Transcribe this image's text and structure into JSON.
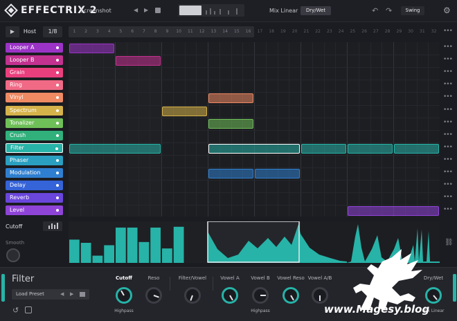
{
  "topbar": {
    "brand": "EFFECTRIX 2",
    "preset": "Screenshot",
    "mix_mode": "Mix Linear",
    "drywet_button": "Dry/Wet",
    "swing_button": "Swing",
    "icons": [
      "logo-icon",
      "prev-arrow-icon",
      "next-arrow-icon",
      "save-icon",
      "undo-icon",
      "redo-icon",
      "gear-icon"
    ]
  },
  "transport": {
    "play_icon": "play-icon",
    "host": "Host",
    "rate": "1/8",
    "steps": [
      "1",
      "2",
      "3",
      "4",
      "5",
      "6",
      "7",
      "8",
      "9",
      "10",
      "11",
      "12",
      "13",
      "14",
      "15",
      "16",
      "17",
      "18",
      "19",
      "20",
      "21",
      "22",
      "23",
      "24",
      "25",
      "26",
      "27",
      "28",
      "29",
      "30",
      "31",
      "32"
    ]
  },
  "effects": [
    {
      "label": "Looper A",
      "color": "#9b34c6"
    },
    {
      "label": "Looper B",
      "color": "#c2328f"
    },
    {
      "label": "Grain",
      "color": "#ea3f7d"
    },
    {
      "label": "Ring",
      "color": "#f06a86"
    },
    {
      "label": "Vinyl",
      "color": "#ef8a63"
    },
    {
      "label": "Spectrum",
      "color": "#d6b24a"
    },
    {
      "label": "Tonalizer",
      "color": "#6fbf58"
    },
    {
      "label": "Crush",
      "color": "#31b07c"
    },
    {
      "label": "Filter",
      "color": "#27b3a7",
      "selected": true
    },
    {
      "label": "Phaser",
      "color": "#2a9fc0"
    },
    {
      "label": "Modulation",
      "color": "#2f7fd0"
    },
    {
      "label": "Delay",
      "color": "#3563d8"
    },
    {
      "label": "Reverb",
      "color": "#6a46dc"
    },
    {
      "label": "Level",
      "color": "#8f44d8"
    }
  ],
  "sequence_blocks": [
    {
      "row": 0,
      "start": 1,
      "length": 4
    },
    {
      "row": 1,
      "start": 5,
      "length": 4
    },
    {
      "row": 4,
      "start": 13,
      "length": 4
    },
    {
      "row": 5,
      "start": 9,
      "length": 4
    },
    {
      "row": 6,
      "start": 13,
      "length": 4
    },
    {
      "row": 8,
      "start": 1,
      "length": 8
    },
    {
      "row": 8,
      "start": 13,
      "length": 8
    },
    {
      "row": 8,
      "start": 21,
      "length": 4
    },
    {
      "row": 8,
      "start": 25,
      "length": 4
    },
    {
      "row": 8,
      "start": 29,
      "length": 4
    },
    {
      "row": 10,
      "start": 13,
      "length": 4
    },
    {
      "row": 10,
      "start": 17,
      "length": 4
    },
    {
      "row": 13,
      "start": 25,
      "length": 8
    }
  ],
  "lane": {
    "label": "Cutoff",
    "smooth_label": "Smooth",
    "steps_level": [
      0.58,
      0.5,
      0.18,
      0.44,
      0.88,
      0.88,
      0.52,
      0.88,
      0.36,
      0.9
    ]
  },
  "panel": {
    "title": "Filter",
    "load_preset": "Load Preset",
    "knobs": [
      {
        "label": "Cutoff",
        "sub": "Highpass",
        "emphasis": true
      },
      {
        "label": "Reso",
        "sub": ""
      },
      {
        "label": "Filter/Vowel",
        "sub": ""
      },
      {
        "label": "Vowel A",
        "sub": ""
      },
      {
        "label": "Vowel B",
        "sub": "Highpass"
      },
      {
        "label": "Vowel Reso",
        "sub": ""
      },
      {
        "label": "Vowel A/B",
        "sub": ""
      },
      {
        "label": "Dry/Wet",
        "sub": "Mix Linear"
      }
    ]
  },
  "watermark": "www.Magesy.blog"
}
